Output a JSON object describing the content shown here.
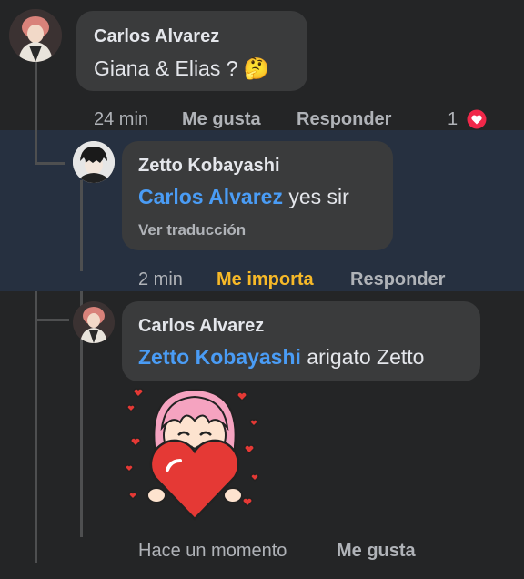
{
  "comments": [
    {
      "author": "Carlos Alvarez",
      "text": "Giana & Elias ? 🤔",
      "time": "24 min",
      "like_label": "Me gusta",
      "reply_label": "Responder",
      "reaction_count": "1",
      "reaction_icon": "heart-reaction-icon"
    },
    {
      "author": "Zetto Kobayashi",
      "mention": "Carlos Alvarez",
      "text": " yes sir",
      "translate_label": "Ver traducción",
      "time": "2 min",
      "like_label": "Me importa",
      "like_color": "#f7b928",
      "reply_label": "Responder"
    },
    {
      "author": "Carlos Alvarez",
      "mention": "Zetto Kobayashi",
      "text": " arigato Zetto",
      "sticker": "girl-holding-heart-sticker",
      "time": "Hace un momento",
      "like_label": "Me gusta"
    }
  ],
  "colors": {
    "background": "#242526",
    "bubble": "#3a3b3c",
    "highlight": "#263040",
    "mention": "#4a9cf5",
    "meta": "#b0b3b8",
    "heart": "#f02849"
  }
}
